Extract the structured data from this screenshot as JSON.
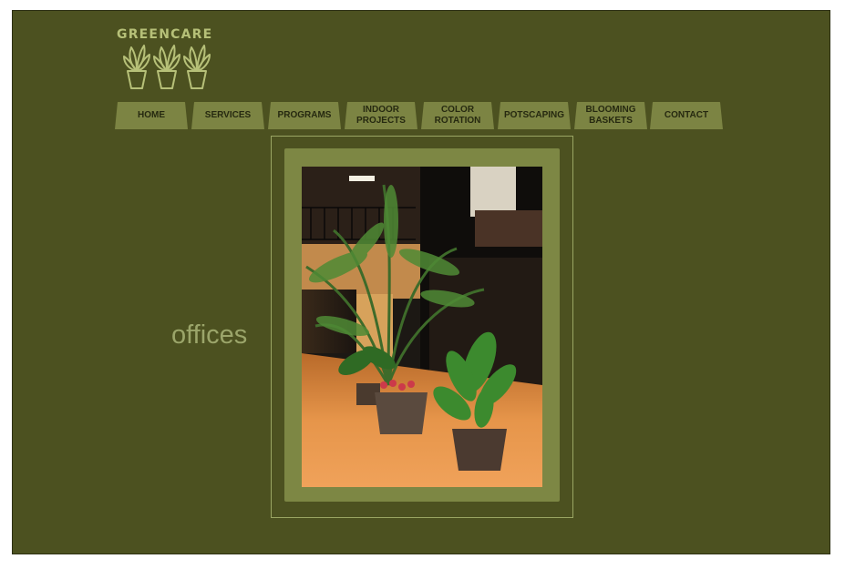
{
  "brand": {
    "name": "GREENCARE",
    "logo_icon": "three-potted-plants-icon"
  },
  "nav": {
    "tabs": [
      {
        "label": "HOME"
      },
      {
        "label": "SERVICES"
      },
      {
        "label": "PROGRAMS"
      },
      {
        "label": "INDOOR\nPROJECTS"
      },
      {
        "label": "COLOR\nROTATION"
      },
      {
        "label": "POTSCAPING"
      },
      {
        "label": "BLOOMING\nBASKETS"
      },
      {
        "label": "CONTACT"
      }
    ]
  },
  "gallery": {
    "caption": "offices",
    "photo_description_icon": "office-lobby-plants-photo"
  },
  "colors": {
    "page_background": "#4c5120",
    "tab_background": "#7c8443",
    "frame_color": "#7d8744",
    "caption_color": "#9ba56a",
    "logo_color": "#b6c078"
  }
}
